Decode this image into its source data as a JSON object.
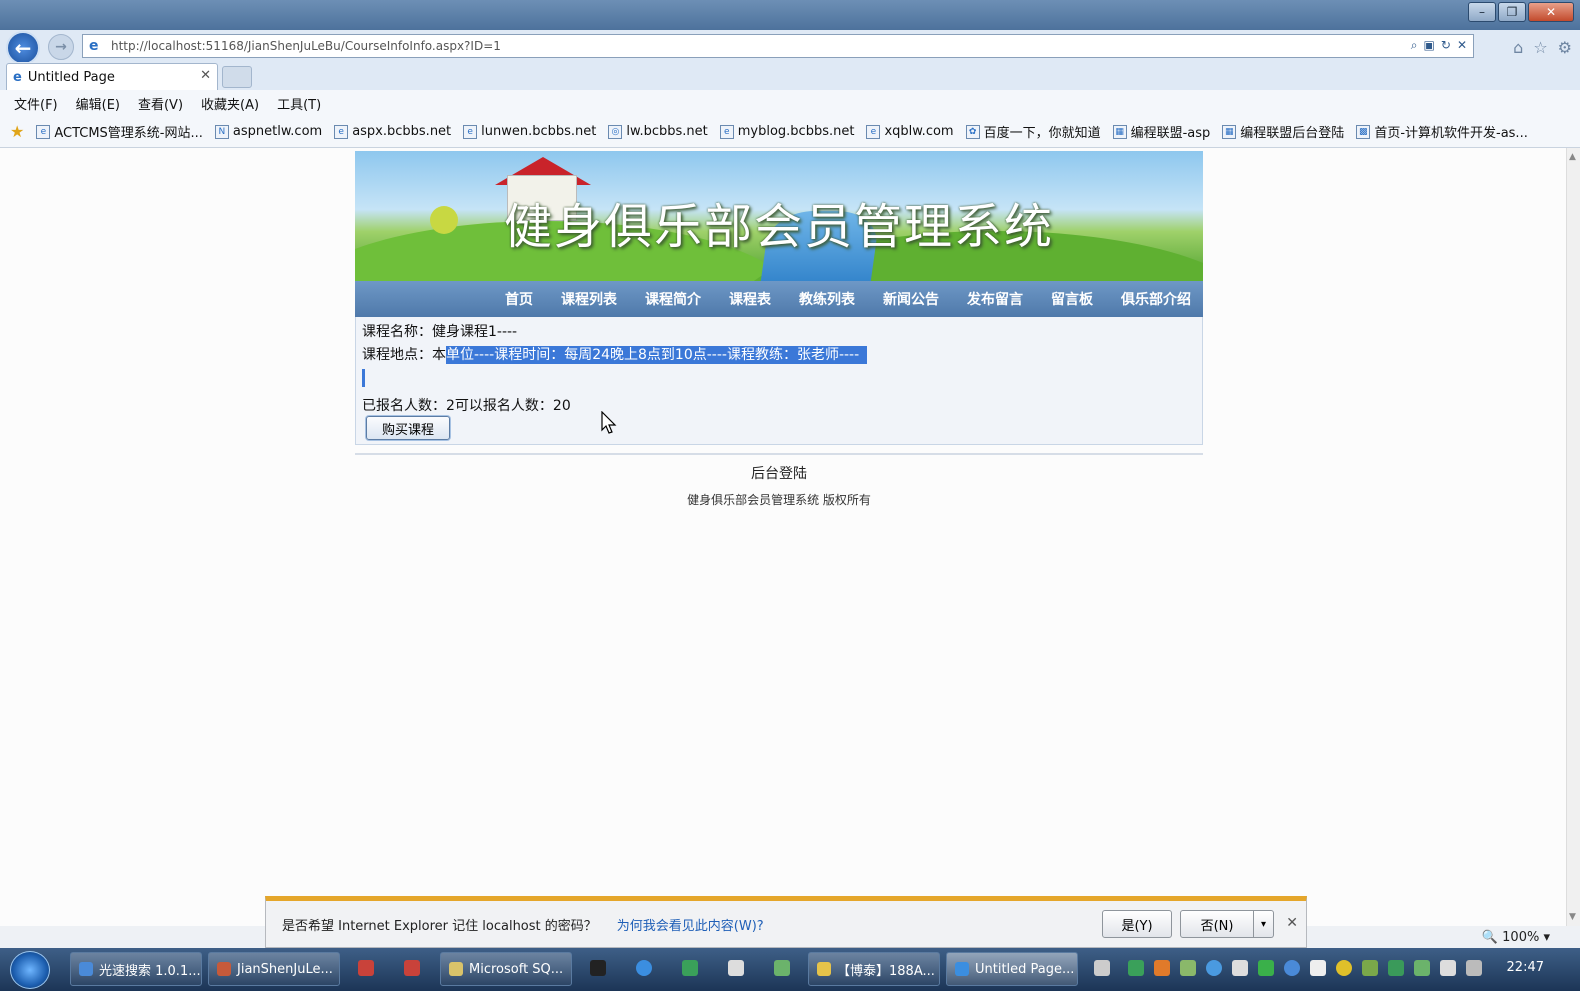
{
  "browser": {
    "url": "http://localhost:51168/JianShenJuLeBu/CourseInfoInfo.aspx?ID=1",
    "tab_title": "Untitled Page",
    "menu": [
      "文件(F)",
      "编辑(E)",
      "查看(V)",
      "收藏夹(A)",
      "工具(T)"
    ],
    "favorites": [
      "ACTCMS管理系统-网站...",
      "aspnetlw.com",
      "aspx.bcbbs.net",
      "lunwen.bcbbs.net",
      "lw.bcbbs.net",
      "myblog.bcbbs.net",
      "xqblw.com",
      "百度一下，你就知道",
      "编程联盟-asp",
      "编程联盟后台登陆",
      "首页-计算机软件开发-as..."
    ],
    "zoom": "100%"
  },
  "site": {
    "banner_title": "健身俱乐部会员管理系统",
    "nav": [
      "首页",
      "课程列表",
      "课程简介",
      "课程表",
      "教练列表",
      "新闻公告",
      "发布留言",
      "留言板",
      "俱乐部介绍"
    ],
    "course_name_label": "课程名称：",
    "course_name": "健身课程1----",
    "course_place_label": "课程地点：",
    "course_place_first": "本",
    "course_place_selected": "单位----课程时间：每周24晚上8点到10点----课程教练：张老师----",
    "enroll_text": "已报名人数：2可以报名人数：20",
    "buy_button": "购买课程",
    "admin_link": "后台登陆",
    "copyright": "健身俱乐部会员管理系统  版权所有"
  },
  "notification": {
    "question": "是否希望 Internet Explorer 记住 localhost 的密码？",
    "why_link": "为何我会看见此内容(W)?",
    "yes": "是(Y)",
    "no": "否(N)"
  },
  "taskbar": {
    "items": [
      "光速搜索 1.0.1...",
      "JianShenJuLe...",
      "Microsoft SQ...",
      "【博泰】188A...",
      "Untitled Page..."
    ],
    "clock": "22:47"
  },
  "colors": {
    "nav_bar": "#5a84b6",
    "selection": "#3b78d8",
    "notify_accent": "#e5a62a"
  }
}
